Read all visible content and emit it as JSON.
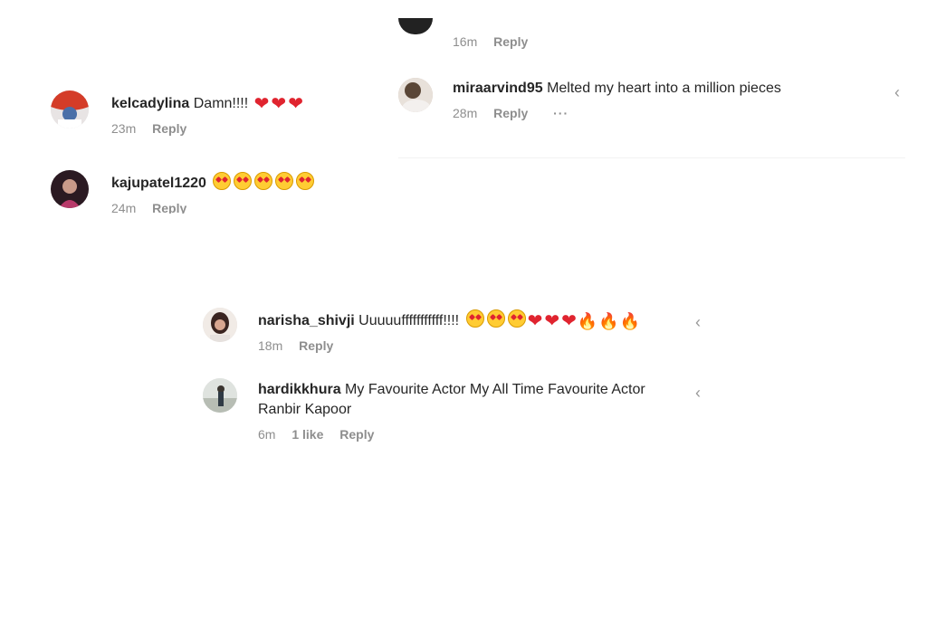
{
  "top_right": {
    "partial_comment": {
      "time": "16m",
      "reply": "Reply"
    },
    "comment": {
      "username": "miraarvind95",
      "text": "Melted my heart into a million pieces",
      "time": "28m",
      "reply": "Reply",
      "more_icon": "···"
    }
  },
  "top_left": {
    "comments": [
      {
        "username": "kelcadylina",
        "text": "Damn!!!!",
        "hearts": [
          "❤",
          "❤",
          "❤"
        ],
        "time": "23m",
        "reply": "Reply"
      },
      {
        "username": "kajupatel1220",
        "emoji_count": 5,
        "time": "24m",
        "reply": "Reply"
      }
    ]
  },
  "bottom": {
    "comments": [
      {
        "username": "narisha_shivji",
        "text": "Uuuuufffffffffff!!!!",
        "hearts": [
          "❤",
          "❤",
          "❤"
        ],
        "fires": [
          "🔥",
          "🔥",
          "🔥"
        ],
        "time": "18m",
        "reply": "Reply"
      },
      {
        "username": "hardikkhura",
        "text_line1": "My Favourite Actor My All Time Favourite Actor",
        "text_line2": "Ranbir Kapoor",
        "time": "6m",
        "likes": "1 like",
        "reply": "Reply"
      }
    ]
  },
  "icons": {
    "heart_like": "chevron-left-icon",
    "avatar": "avatar"
  },
  "colors": {
    "text": "#262626",
    "meta": "#8e8e8e",
    "heart": "#e0242f",
    "emoji": "#ffcc33"
  }
}
